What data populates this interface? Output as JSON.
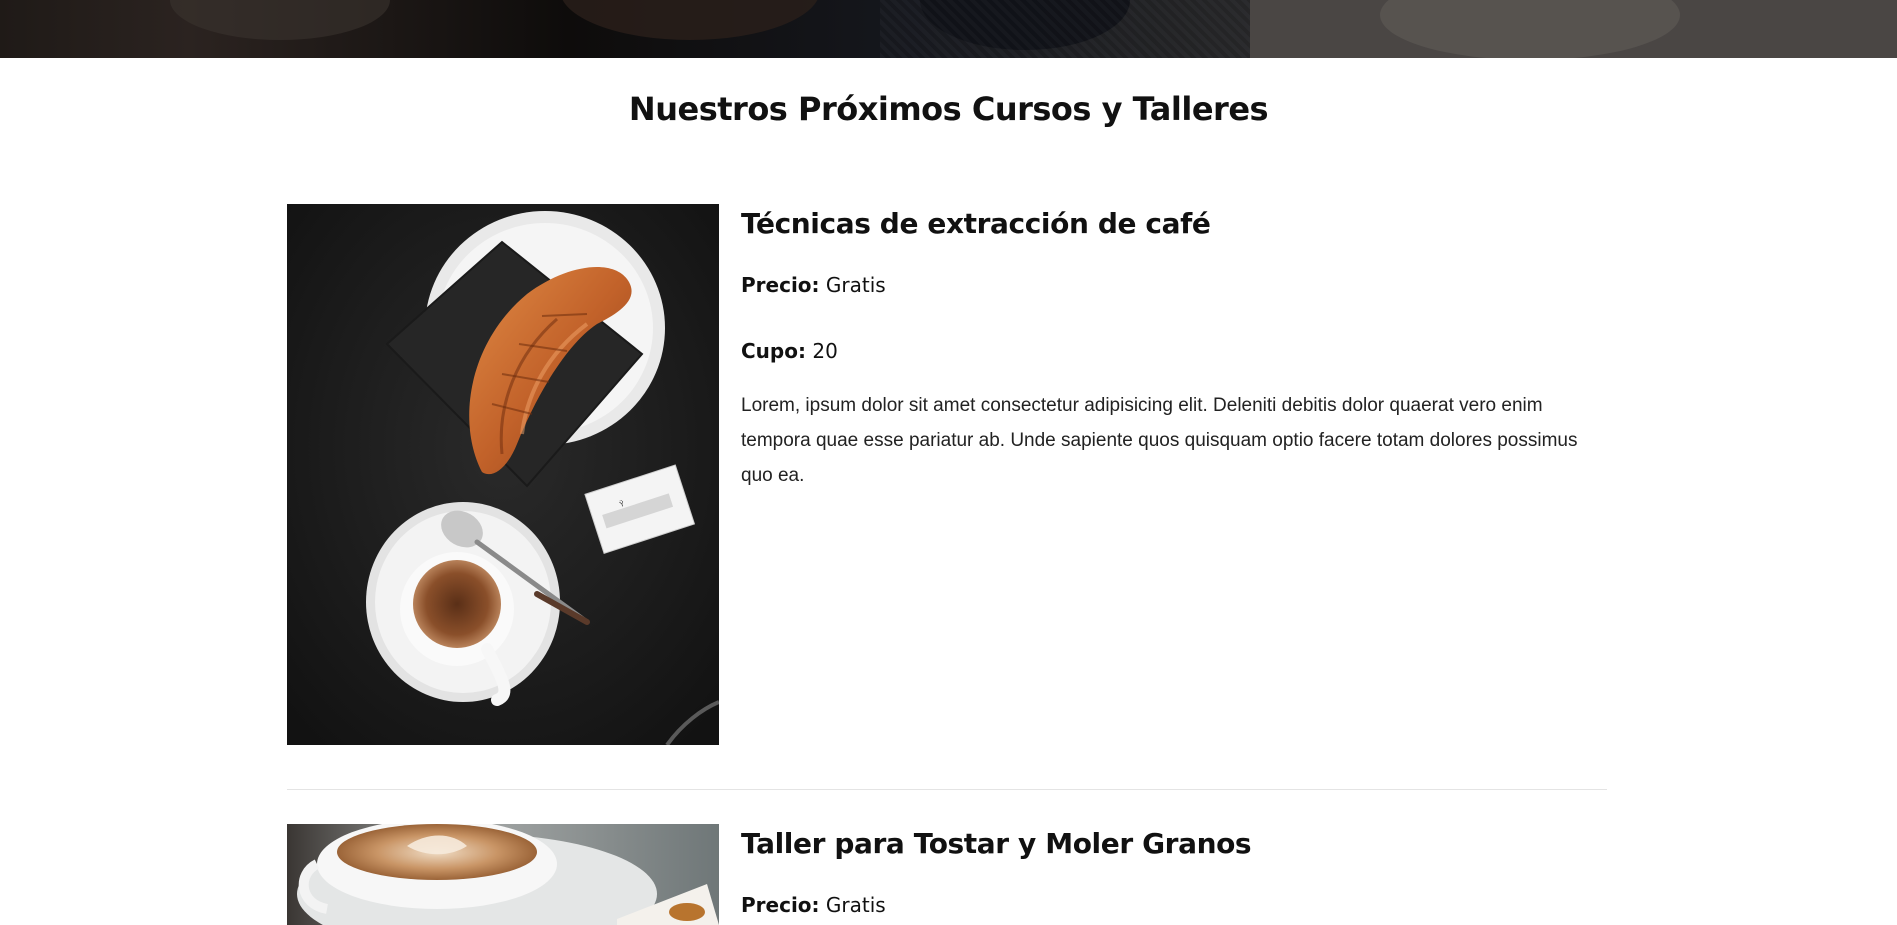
{
  "section": {
    "title": "Nuestros Próximos Cursos y Talleres"
  },
  "courses": [
    {
      "title": "Técnicas de extracción de café",
      "price_label": "Precio:",
      "price_value": "Gratis",
      "capacity_label": "Cupo:",
      "capacity_value": "20",
      "description": "Lorem, ipsum dolor sit amet consectetur adipisicing elit. Deleniti debitis dolor quaerat vero enim tempora quae esse pariatur ab. Unde sapiente quos quisquam optio facere totam dolores possimus quo ea.",
      "image": "croissant-and-espresso-photo"
    },
    {
      "title": "Taller para Tostar y Moler Granos",
      "price_label": "Precio:",
      "price_value": "Gratis",
      "image": "latte-art-cup-photo"
    }
  ],
  "colors": {
    "text": "#111111",
    "divider": "#e4e4e4",
    "hero_dark": "#0e0c0b"
  }
}
